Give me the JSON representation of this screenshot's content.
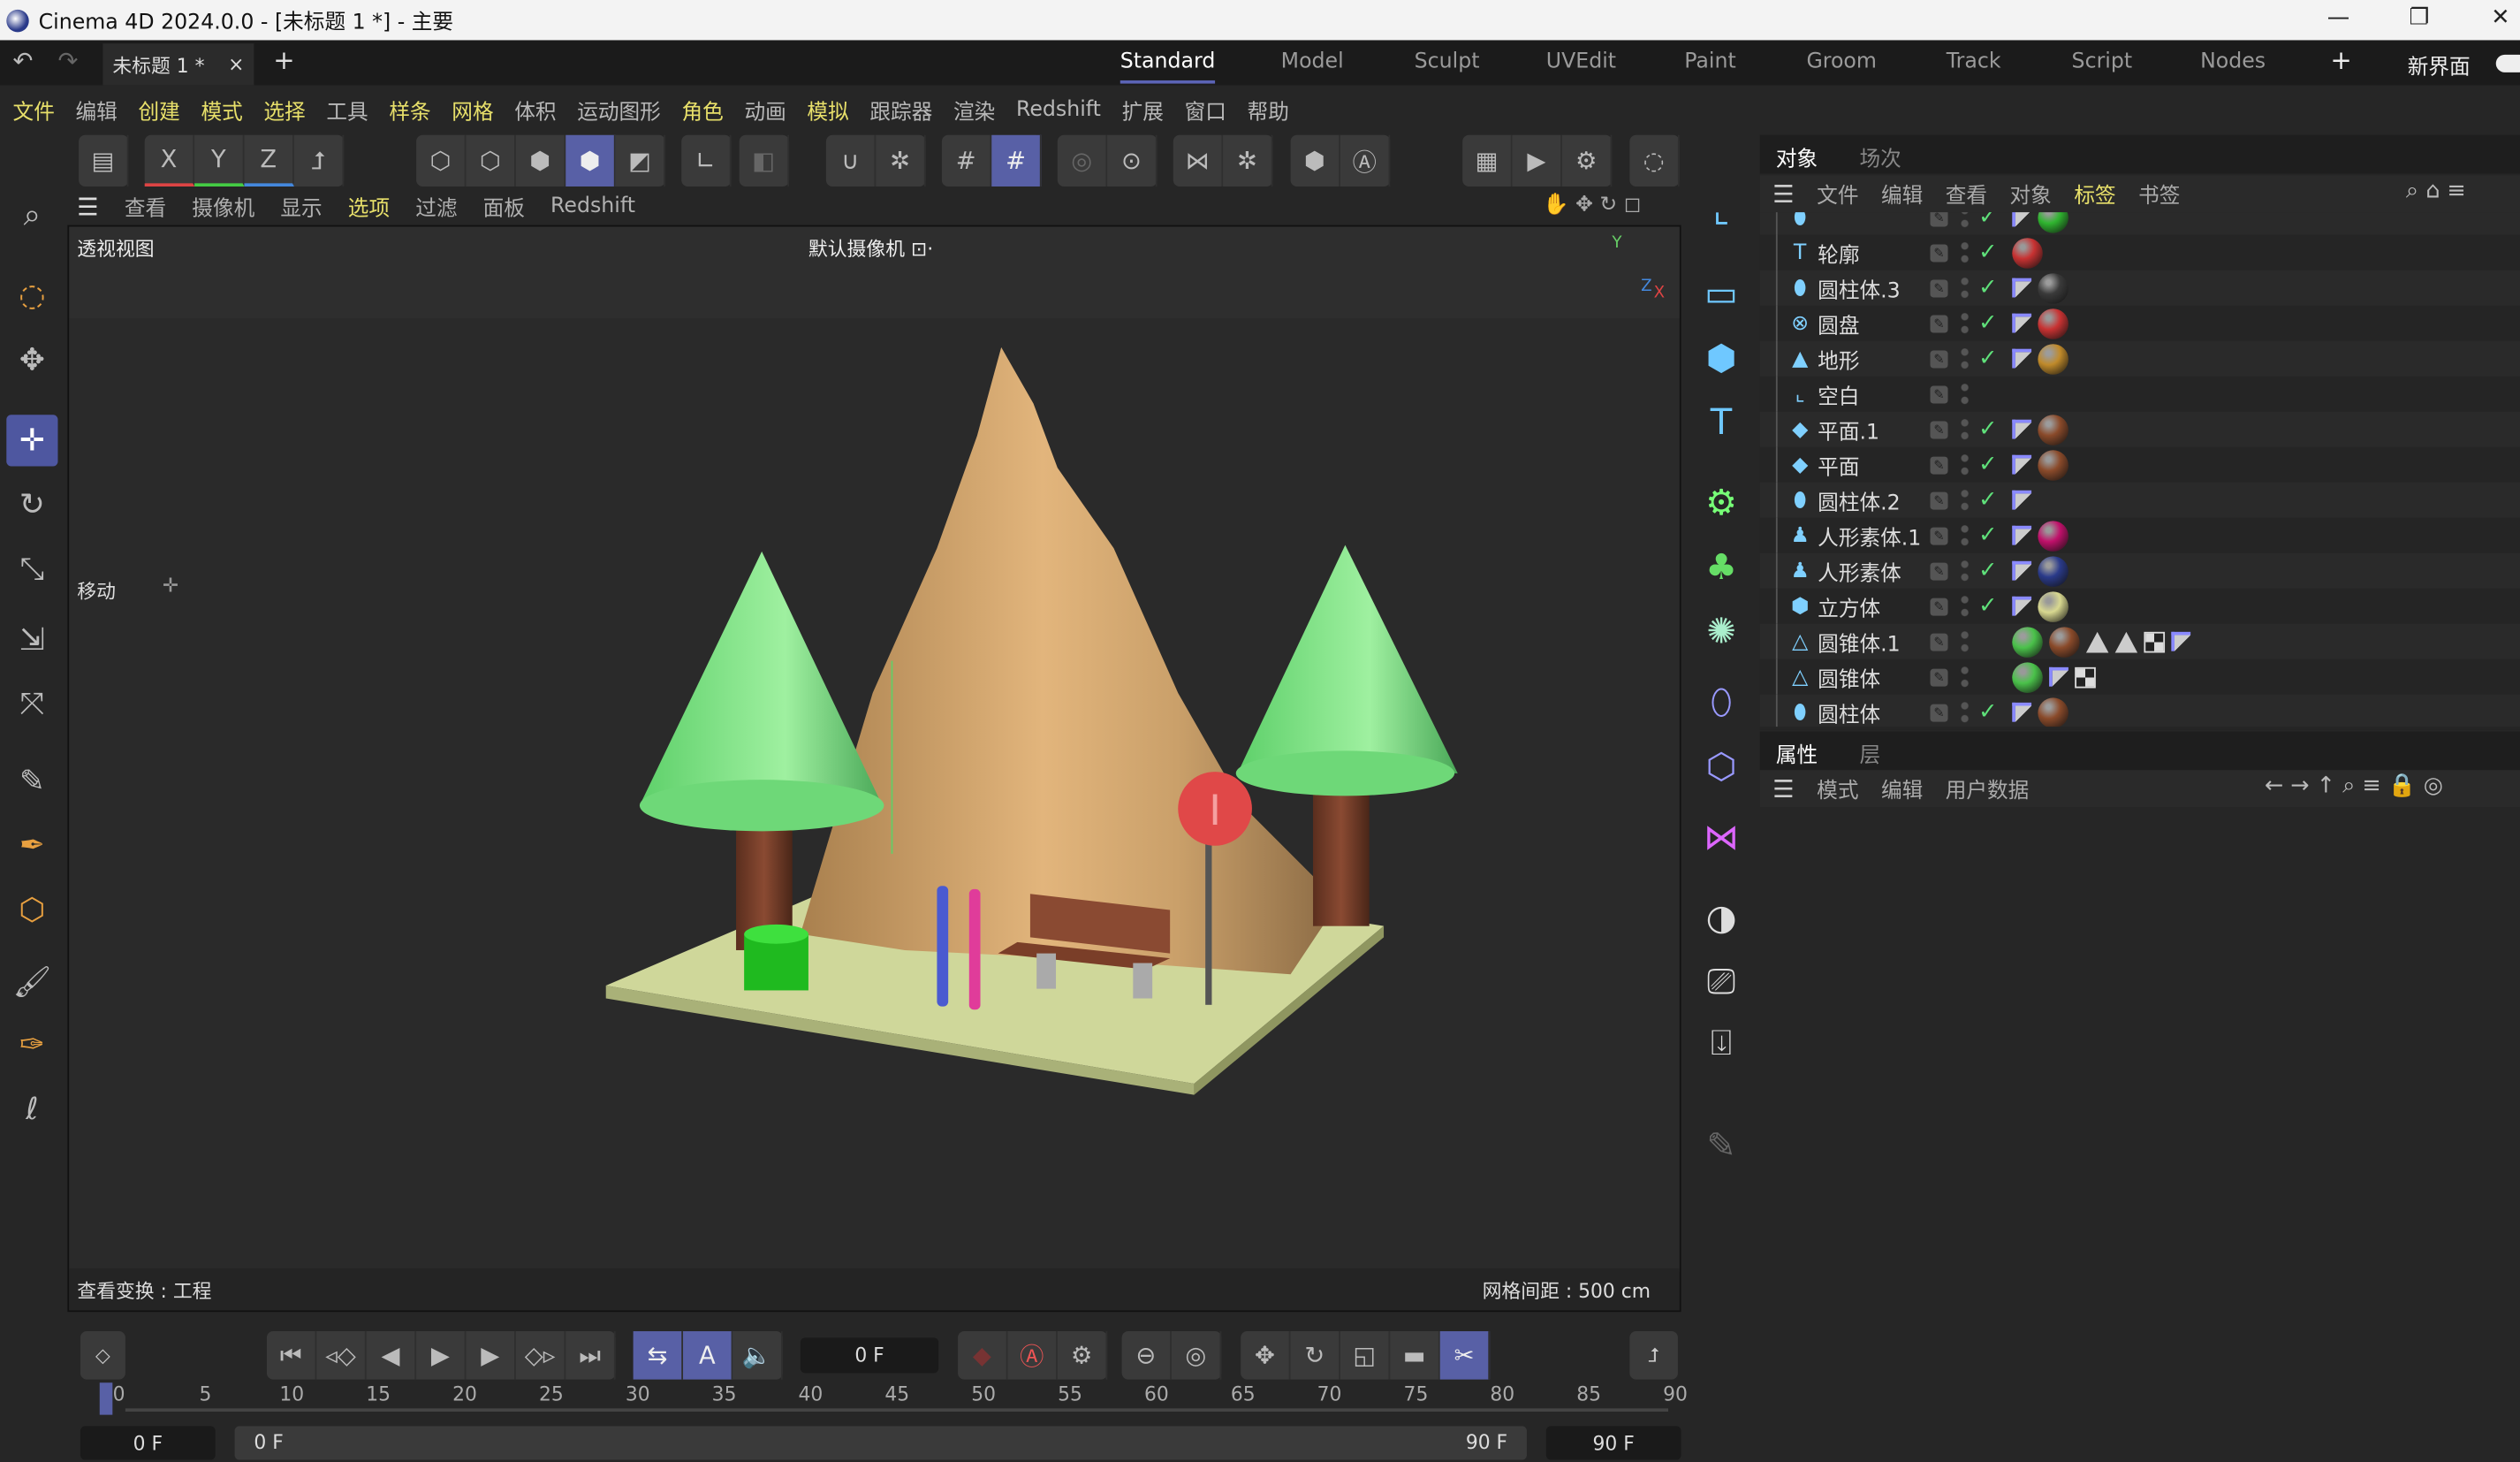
{
  "window": {
    "title": "Cinema 4D 2024.0.0 - [未标题 1 *] - 主要",
    "minimize": "—",
    "restore": "❐",
    "close": "✕"
  },
  "doc_tab": {
    "label": "未标题 1 *",
    "close": "×",
    "add": "+"
  },
  "layouts": [
    {
      "label": "Standard",
      "active": true
    },
    {
      "label": "Model"
    },
    {
      "label": "Sculpt"
    },
    {
      "label": "UVEdit"
    },
    {
      "label": "Paint"
    },
    {
      "label": "Groom"
    },
    {
      "label": "Track"
    },
    {
      "label": "Script"
    },
    {
      "label": "Nodes"
    }
  ],
  "layout_add": "+",
  "new_layout": "新界面",
  "menu": [
    {
      "label": "文件",
      "hl": true
    },
    {
      "label": "编辑"
    },
    {
      "label": "创建",
      "hl": true
    },
    {
      "label": "模式",
      "hl": true
    },
    {
      "label": "选择",
      "hl": true
    },
    {
      "label": "工具"
    },
    {
      "label": "样条",
      "hl": true
    },
    {
      "label": "网格",
      "hl": true
    },
    {
      "label": "体积"
    },
    {
      "label": "运动图形"
    },
    {
      "label": "角色",
      "hl": true
    },
    {
      "label": "动画"
    },
    {
      "label": "模拟",
      "hl": true
    },
    {
      "label": "跟踪器"
    },
    {
      "label": "渲染"
    },
    {
      "label": "Redshift"
    },
    {
      "label": "扩展"
    },
    {
      "label": "窗口"
    },
    {
      "label": "帮助"
    }
  ],
  "toolbar": {
    "x": "X",
    "y": "Y",
    "z": "Z"
  },
  "viewport": {
    "menu": [
      {
        "label": "查看"
      },
      {
        "label": "摄像机"
      },
      {
        "label": "显示"
      },
      {
        "label": "选项",
        "hl": true
      },
      {
        "label": "过滤"
      },
      {
        "label": "面板"
      },
      {
        "label": "Redshift"
      }
    ],
    "view_name": "透视视图",
    "camera": "默认摄像机 ⊡·",
    "tool_label": "移动",
    "status_left": "查看变换 : 工程",
    "status_right": "网格间距 : 500 cm",
    "axis": {
      "y": "Y",
      "z": "Z",
      "x": "X"
    }
  },
  "object_manager": {
    "tabs": [
      "对象",
      "场次"
    ],
    "menu": [
      {
        "label": "文件"
      },
      {
        "label": "编辑"
      },
      {
        "label": "查看"
      },
      {
        "label": "对象"
      },
      {
        "label": "标签",
        "hl": true
      },
      {
        "label": "书签"
      }
    ],
    "rows": [
      {
        "name": "",
        "icon": "cylinder-icon",
        "glyph": "⬮",
        "check": true,
        "tags": [
          "phong",
          "mat:#2fb52f"
        ]
      },
      {
        "name": "轮廓",
        "icon": "text-icon",
        "glyph": "T",
        "check": true,
        "tags": [
          "mat:#c83232"
        ]
      },
      {
        "name": "圆柱体.3",
        "icon": "cylinder-icon",
        "glyph": "⬮",
        "check": true,
        "tags": [
          "phong",
          "mat:#3a3a3a"
        ]
      },
      {
        "name": "圆盘",
        "icon": "disc-icon",
        "glyph": "⊗",
        "check": true,
        "tags": [
          "phong",
          "mat:#c83232"
        ]
      },
      {
        "name": "地形",
        "icon": "landscape-icon",
        "glyph": "▲",
        "check": true,
        "tags": [
          "phong",
          "mat:#c08a2a"
        ]
      },
      {
        "name": "空白",
        "icon": "null-icon",
        "glyph": "⌞",
        "check": false,
        "tags": []
      },
      {
        "name": "平面.1",
        "icon": "plane-icon",
        "glyph": "◆",
        "check": true,
        "tags": [
          "phong",
          "mat:#8a4a2a"
        ]
      },
      {
        "name": "平面",
        "icon": "plane-icon",
        "glyph": "◆",
        "check": true,
        "tags": [
          "phong",
          "mat:#8a4a2a"
        ]
      },
      {
        "name": "圆柱体.2",
        "icon": "cylinder-icon",
        "glyph": "⬮",
        "check": true,
        "tags": [
          "phong"
        ]
      },
      {
        "name": "人形素体.1",
        "icon": "figure-icon",
        "glyph": "♟",
        "check": true,
        "tags": [
          "phong",
          "mat:#c0106a"
        ]
      },
      {
        "name": "人形素体",
        "icon": "figure-icon",
        "glyph": "♟",
        "check": true,
        "tags": [
          "phong",
          "mat:#2a3a8a"
        ]
      },
      {
        "name": "立方体",
        "icon": "cube-icon",
        "glyph": "⬢",
        "check": true,
        "tags": [
          "phong",
          "mat:#d8d890"
        ]
      },
      {
        "name": "圆锥体.1",
        "icon": "cone-icon",
        "glyph": "△",
        "check": false,
        "tags": [
          "mat:#4ac24a",
          "mat:#8a4a2a",
          "tri",
          "tri",
          "checker",
          "phong"
        ]
      },
      {
        "name": "圆锥体",
        "icon": "cone-icon",
        "glyph": "△",
        "check": false,
        "tags": [
          "mat:#4ac24a",
          "phong",
          "checker"
        ]
      },
      {
        "name": "圆柱体",
        "icon": "cylinder-icon",
        "glyph": "⬮",
        "check": true,
        "tags": [
          "phong",
          "mat:#8a4a2a"
        ]
      }
    ]
  },
  "attributes": {
    "tabs": [
      "属性",
      "层"
    ],
    "menu": [
      "模式",
      "编辑",
      "用户数据"
    ]
  },
  "timeline": {
    "current_frame": "0 F",
    "ticks": [
      "0",
      "5",
      "10",
      "15",
      "20",
      "25",
      "30",
      "35",
      "40",
      "45",
      "50",
      "55",
      "60",
      "65",
      "70",
      "75",
      "80",
      "85",
      "90"
    ],
    "start": "0 F",
    "range_start": "0 F",
    "range_end": "90 F",
    "end": "90 F",
    "playhead_frame": 0
  },
  "colors": {
    "accent": "#5860a6",
    "highlight_text": "#e8e06a",
    "check": "#5fe07a"
  }
}
